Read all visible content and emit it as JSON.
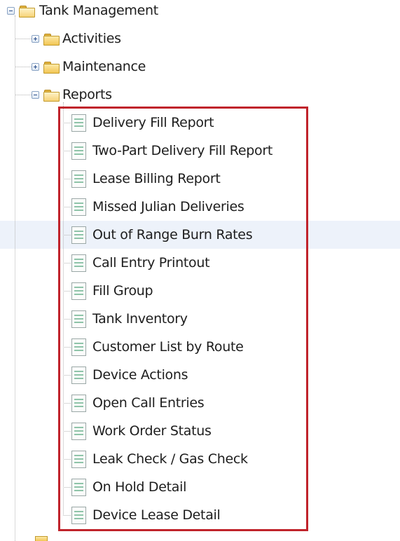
{
  "tree": {
    "root": {
      "label": "Tank Management",
      "icon": "folder-open-icon",
      "expanded": true
    },
    "folders": [
      {
        "label": "Activities",
        "icon": "folder-icon",
        "expanded": false
      },
      {
        "label": "Maintenance",
        "icon": "folder-icon",
        "expanded": false
      },
      {
        "label": "Reports",
        "icon": "folder-open-icon",
        "expanded": true
      }
    ],
    "reports": [
      {
        "label": "Delivery Fill Report",
        "icon": "report-document-icon"
      },
      {
        "label": "Two-Part Delivery Fill Report",
        "icon": "report-document-icon"
      },
      {
        "label": "Lease Billing Report",
        "icon": "report-document-icon"
      },
      {
        "label": "Missed Julian Deliveries",
        "icon": "report-document-icon"
      },
      {
        "label": "Out of Range Burn Rates",
        "icon": "report-document-icon",
        "hovered": true
      },
      {
        "label": "Call Entry Printout",
        "icon": "report-document-icon"
      },
      {
        "label": "Fill Group",
        "icon": "report-document-icon"
      },
      {
        "label": "Tank Inventory",
        "icon": "report-document-icon"
      },
      {
        "label": "Customer List by Route",
        "icon": "report-document-icon"
      },
      {
        "label": "Device Actions",
        "icon": "report-document-icon"
      },
      {
        "label": "Open Call Entries",
        "icon": "report-document-icon"
      },
      {
        "label": "Work Order Status",
        "icon": "report-document-icon"
      },
      {
        "label": "Leak Check / Gas Check",
        "icon": "report-document-icon"
      },
      {
        "label": "On Hold Detail",
        "icon": "report-document-icon"
      },
      {
        "label": "Device Lease Detail",
        "icon": "report-document-icon"
      }
    ]
  },
  "colors": {
    "highlight_border": "#c0232b",
    "hover_row": "#edf2fa",
    "folder": "#f2c654",
    "toggle_border": "#8aa3c4"
  }
}
